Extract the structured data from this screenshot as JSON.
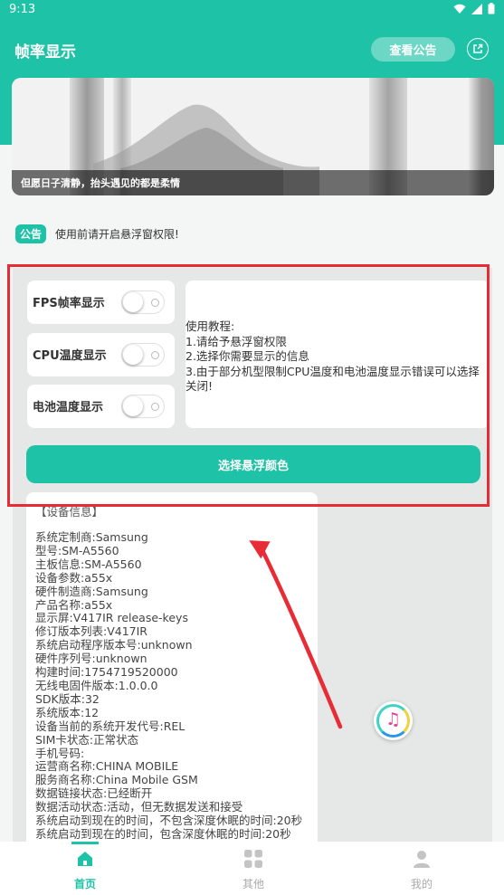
{
  "status_bar": {
    "time": "9:13"
  },
  "app_bar": {
    "title": "帧率显示",
    "notice_button": "查看公告"
  },
  "banner": {
    "caption": "但愿日子清静，抬头遇见的都是柔情"
  },
  "announcement": {
    "badge": "公告",
    "text": "使用前请开启悬浮窗权限!"
  },
  "toggles": [
    {
      "label": "FPS帧率显示",
      "on": false
    },
    {
      "label": "CPU温度显示",
      "on": false
    },
    {
      "label": "电池温度显示",
      "on": false
    }
  ],
  "tutorial": {
    "text": "使用教程:\n1.请给予悬浮窗权限\n2.选择你需要显示的信息\n3.由于部分机型限制CPU温度和电池温度显示错误可以选择关闭!"
  },
  "color_button": "选择悬浮颜色",
  "device_info": {
    "header": "【设备信息】",
    "lines": [
      "系统定制商:Samsung",
      "型号:SM-A5560",
      "主板信息:SM-A5560",
      "设备参数:a55x",
      "硬件制造商:Samsung",
      "产品名称:a55x",
      "显示屏:V417IR release-keys",
      "修订版本列表:V417IR",
      "系统启动程序版本号:unknown",
      "硬件序列号:unknown",
      "构建时间:1754719520000",
      "无线电固件版本:1.0.0.0",
      "SDK版本:32",
      "系统版本:12",
      "设备当前的系统开发代号:REL",
      "SIM卡状态:正常状态",
      "手机号码:",
      "运营商名称:CHINA MOBILE",
      "服务商名称:China Mobile GSM",
      "数据链接状态:已经断开",
      "数据活动状态:活动，但无数据发送和接受",
      "系统启动到现在的时间，不包含深度休眠的时间:20秒",
      "系统启动到现在的时间，包含深度休眠的时间:20秒"
    ]
  },
  "bottom_nav": [
    {
      "label": "首页",
      "icon": "home-icon",
      "active": true
    },
    {
      "label": "其他",
      "icon": "grid-icon",
      "active": false
    },
    {
      "label": "我的",
      "icon": "person-icon",
      "active": false
    }
  ],
  "colors": {
    "accent": "#1ec2a6",
    "highlight_box": "#e82c35",
    "inactive_nav": "#c4c4c4"
  }
}
